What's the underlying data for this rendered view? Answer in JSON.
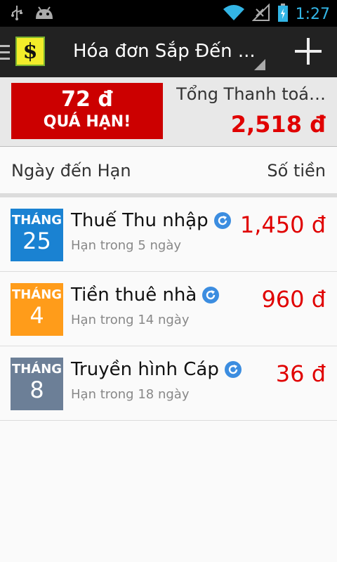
{
  "status_bar": {
    "time": "1:27"
  },
  "action_bar": {
    "title": "Hóa đơn Sắp Đến ..."
  },
  "summary": {
    "overdue_amount": "72 đ",
    "overdue_label": "QUÁ HẠN!",
    "total_label": "Tổng Thanh toá…",
    "total_value": "2,518 đ"
  },
  "list_header": {
    "due_date": "Ngày đến Hạn",
    "amount": "Số tiền"
  },
  "bills": [
    {
      "month": "THÁNG",
      "day": "25",
      "name": "Thuế Thu nhập",
      "due": "Hạn trong 5 ngày",
      "amount": "1,450 đ",
      "color": "#1a82d2"
    },
    {
      "month": "THÁNG",
      "day": "4",
      "name": "Tiền thuê nhà",
      "due": "Hạn trong 14 ngày",
      "amount": "960 đ",
      "color": "#ff9c1a"
    },
    {
      "month": "THÁNG",
      "day": "8",
      "name": "Truyền hình Cáp",
      "due": "Hạn trong 18 ngày",
      "amount": "36 đ",
      "color": "#6c7f97"
    }
  ],
  "colors": {
    "accent_red": "#e00000",
    "overdue_bg": "#cc0000"
  }
}
